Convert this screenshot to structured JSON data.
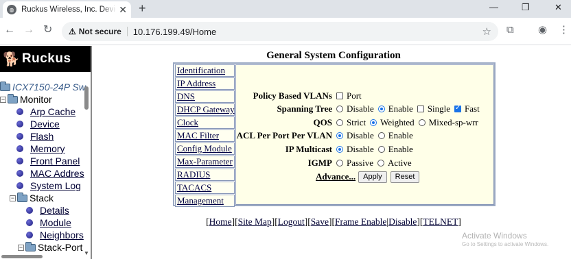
{
  "browser": {
    "tab_title": "Ruckus Wireless, Inc. Device Ma",
    "url_security": "Not secure",
    "url": "10.176.199.49/Home"
  },
  "logo": {
    "text": "Ruckus"
  },
  "tree": {
    "device": "ICX7150-24P Sw",
    "monitor": "Monitor",
    "monitor_items": [
      "Arp Cache",
      "Device",
      "Flash",
      "Memory",
      "Front Panel",
      "MAC Addres",
      "System Log"
    ],
    "stack": "Stack",
    "stack_items": [
      "Details",
      "Module",
      "Neighbors"
    ],
    "stack_port": "Stack-Port"
  },
  "page": {
    "title": "General System Configuration",
    "menu": [
      "Identification",
      "IP Address",
      "DNS",
      "DHCP Gateway",
      "Clock",
      "MAC Filter",
      "Config Module",
      "Max-Parameter",
      "RADIUS",
      "TACACS",
      "Management"
    ]
  },
  "form": {
    "policy_vlans": {
      "label": "Policy Based VLANs",
      "option": "Port",
      "checked": false
    },
    "spanning_tree": {
      "label": "Spanning Tree",
      "options": [
        "Disable",
        "Enable",
        "Single",
        "Fast"
      ],
      "selected": "Enable",
      "single_checked": false,
      "fast_checked": true
    },
    "qos": {
      "label": "QOS",
      "options": [
        "Strict",
        "Weighted",
        "Mixed-sp-wrr"
      ],
      "selected": "Weighted"
    },
    "acl": {
      "label": "ACL Per Port Per VLAN",
      "options": [
        "Disable",
        "Enable"
      ],
      "selected": "Disable"
    },
    "ip_multicast": {
      "label": "IP Multicast",
      "options": [
        "Disable",
        "Enable"
      ],
      "selected": "Disable"
    },
    "igmp": {
      "label": "IGMP",
      "options": [
        "Passive",
        "Active"
      ],
      "selected": "none"
    },
    "advance": "Advance...",
    "apply": "Apply",
    "reset": "Reset"
  },
  "footer": {
    "links": [
      "Home",
      "Site Map",
      "Logout",
      "Save",
      "Frame Enable",
      "Disable",
      "TELNET"
    ]
  },
  "watermark": {
    "line1": "Activate Windows",
    "line2": "Go to Settings to activate Windows."
  }
}
